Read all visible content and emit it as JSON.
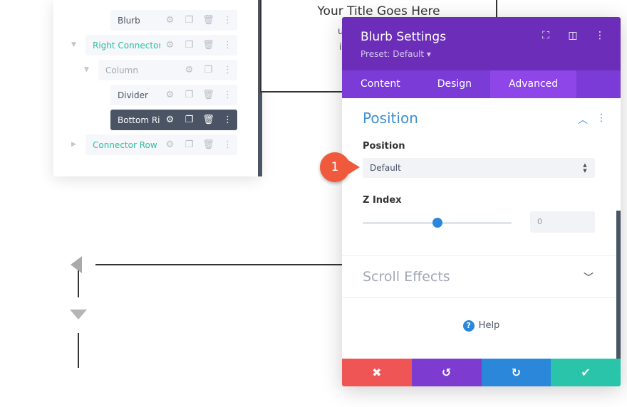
{
  "layers": {
    "items": [
      {
        "label": "Blurb",
        "style": "normal"
      },
      {
        "label": "Right Connector...",
        "style": "teal"
      },
      {
        "label": "Column",
        "style": "muted"
      },
      {
        "label": "Divider",
        "style": "normal"
      },
      {
        "label": "Bottom Ri...",
        "style": "dark"
      },
      {
        "label": "Connector Row",
        "style": "teal"
      }
    ]
  },
  "canvas": {
    "title": "Your Title Goes Here",
    "line1": "ur content goes h",
    "line2": "inline or in the m"
  },
  "modal": {
    "title": "Blurb Settings",
    "preset": "Preset: Default ▾",
    "tabs": [
      "Content",
      "Design",
      "Advanced"
    ],
    "active_tab": "Advanced",
    "section_title": "Position",
    "position_label": "Position",
    "position_value": "Default",
    "zindex_label": "Z Index",
    "zindex_value": "0",
    "zindex_slider_fraction": 0.5,
    "scroll_effects": "Scroll Effects",
    "help": "Help"
  },
  "annotation": {
    "badge": "1"
  },
  "colors": {
    "header": "#6c2eb9",
    "tabs": "#7b3bd6",
    "accent": "#2b87da",
    "cancel": "#ef5555",
    "undo": "#7e3bd0",
    "redo": "#2b87da",
    "save": "#29c4a9",
    "badge": "#f05a3c"
  }
}
